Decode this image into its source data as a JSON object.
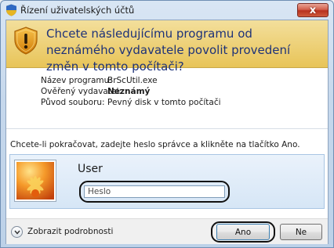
{
  "window": {
    "title": "Řízení uživatelských účtů",
    "close_label": "x"
  },
  "header": {
    "question": "Chcete následujícímu programu od neznámého vydavatele povolit provedení změn v tomto počítači?"
  },
  "info": [
    {
      "label": "Název programu:",
      "value": "BrScUtil.exe",
      "bold": false
    },
    {
      "label": "Ověřený vydavatel:",
      "value": "Neznámý",
      "bold": true
    },
    {
      "label": "Původ souboru:",
      "value": "Pevný disk v tomto počítači",
      "bold": false
    }
  ],
  "instruction": "Chcete-li pokračovat, zadejte heslo správce a klikněte na tlačítko Ano.",
  "credential": {
    "user": "User",
    "password_placeholder": "Heslo"
  },
  "footer": {
    "details_label": "Zobrazit podrobnosti",
    "yes_label": "Ano",
    "no_label": "Ne"
  },
  "colors": {
    "header_bg": "#ecc95e",
    "question_text": "#1e3278",
    "close_button": "#c8442f"
  }
}
